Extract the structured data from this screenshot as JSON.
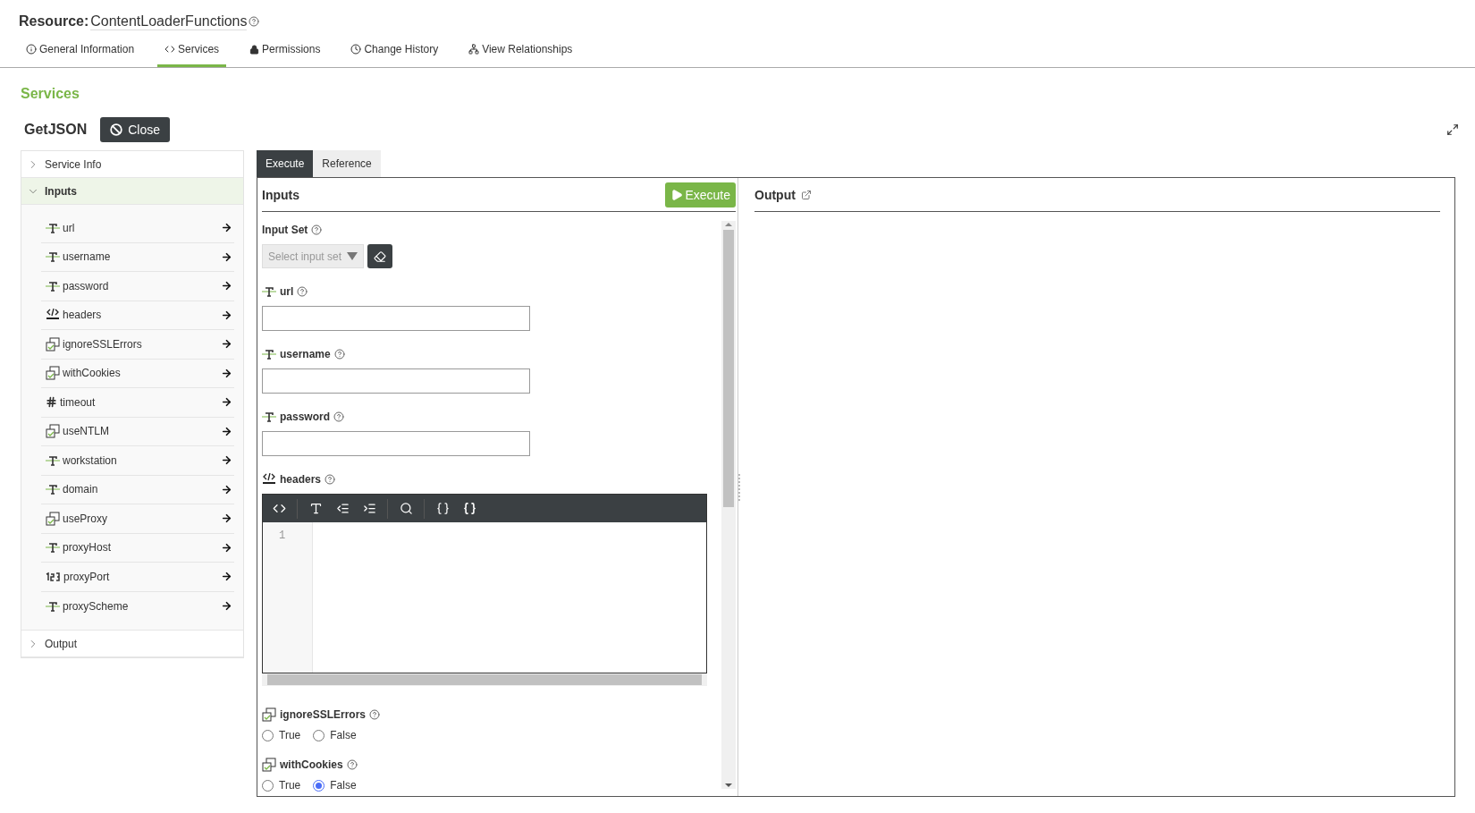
{
  "resource": {
    "label": "Resource:",
    "name": "ContentLoaderFunctions"
  },
  "tabs": [
    {
      "label": "General Information",
      "kind": "info",
      "selected": false
    },
    {
      "label": "Services",
      "kind": "code",
      "selected": true
    },
    {
      "label": "Permissions",
      "kind": "lock",
      "selected": false
    },
    {
      "label": "Change History",
      "kind": "clock",
      "selected": false
    },
    {
      "label": "View Relationships",
      "kind": "hierarchy",
      "selected": false
    }
  ],
  "section_title": "Services",
  "service": {
    "name": "GetJSON",
    "close_label": "Close"
  },
  "sidebar": {
    "sections": [
      {
        "label": "Service Info",
        "expanded": false
      },
      {
        "label": "Inputs",
        "expanded": true,
        "items": [
          {
            "label": "url",
            "kind": "string"
          },
          {
            "label": "username",
            "kind": "string"
          },
          {
            "label": "password",
            "kind": "string"
          },
          {
            "label": "headers",
            "kind": "json"
          },
          {
            "label": "ignoreSSLErrors",
            "kind": "boolean"
          },
          {
            "label": "withCookies",
            "kind": "boolean"
          },
          {
            "label": "timeout",
            "kind": "number"
          },
          {
            "label": "useNTLM",
            "kind": "boolean"
          },
          {
            "label": "workstation",
            "kind": "string"
          },
          {
            "label": "domain",
            "kind": "string"
          },
          {
            "label": "useProxy",
            "kind": "boolean"
          },
          {
            "label": "proxyHost",
            "kind": "string"
          },
          {
            "label": "proxyPort",
            "kind": "integer"
          },
          {
            "label": "proxyScheme",
            "kind": "string"
          }
        ]
      },
      {
        "label": "Output",
        "expanded": false
      }
    ]
  },
  "pane_tabs": [
    {
      "label": "Execute",
      "selected": true
    },
    {
      "label": "Reference",
      "selected": false
    }
  ],
  "inputs": {
    "title": "Inputs",
    "execute_label": "Execute",
    "input_set": {
      "label": "Input Set",
      "placeholder": "Select input set"
    },
    "fields": [
      {
        "label": "url",
        "kind": "string"
      },
      {
        "label": "username",
        "kind": "string"
      },
      {
        "label": "password",
        "kind": "string"
      },
      {
        "label": "headers",
        "kind": "json",
        "line_numbers": [
          "1"
        ]
      },
      {
        "label": "ignoreSSLErrors",
        "kind": "boolean",
        "options": [
          {
            "label": "True",
            "selected": false
          },
          {
            "label": "False",
            "selected": false
          }
        ]
      },
      {
        "label": "withCookies",
        "kind": "boolean",
        "options": [
          {
            "label": "True",
            "selected": false
          },
          {
            "label": "False",
            "selected": true
          }
        ]
      }
    ]
  },
  "output": {
    "title": "Output"
  }
}
